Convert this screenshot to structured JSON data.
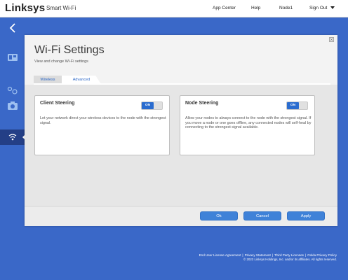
{
  "header": {
    "logo": "Linksys",
    "product": "Smart Wi-Fi",
    "nav": {
      "app_center": "App Center",
      "help": "Help",
      "node": "Node1",
      "sign_out": "Sign Out"
    }
  },
  "panel": {
    "title": "Wi-Fi Settings",
    "subtitle": "View and change Wi-Fi settings",
    "tabs": [
      {
        "label": "Wireless",
        "active": false
      },
      {
        "label": "Advanced",
        "active": true
      }
    ],
    "cards": [
      {
        "title": "Client Steering",
        "toggle": "ON",
        "description": "Let your network direct your wireless devices to the node with the strongest signal."
      },
      {
        "title": "Node Steering",
        "toggle": "ON",
        "description": "Allow your nodes to always connect to the node with the strongest signal. If you move a node or one goes offline, any connected nodes will self-heal by connecting to the strongest signal available."
      }
    ],
    "buttons": {
      "ok": "Ok",
      "cancel": "Cancel",
      "apply": "Apply"
    }
  },
  "footer": {
    "links": [
      "End User License Agreement",
      "Privacy Statement",
      "Third Party Licenses",
      "Ookla Privacy Policy"
    ],
    "separator": "|",
    "copyright": "© 2023 Linksys Holdings, Inc. and/or its affiliates. All rights reserved."
  },
  "colors": {
    "background": "#3a68c8",
    "accent": "#2a6ccf",
    "button": "#3f82d8"
  },
  "icons": [
    "back-arrow-icon",
    "dashboard-icon",
    "devices-icon",
    "camera-icon",
    "wifi-settings-icon",
    "close-icon",
    "chevron-down-icon"
  ]
}
